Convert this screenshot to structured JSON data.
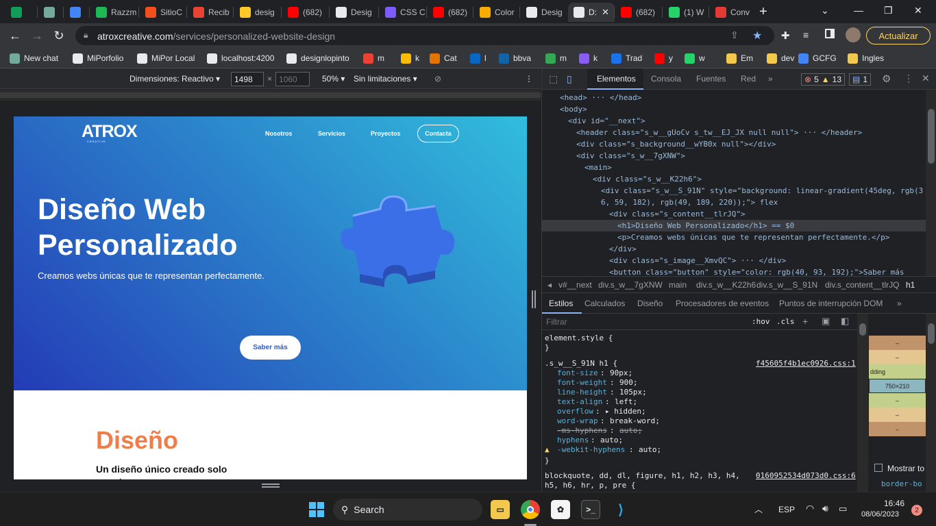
{
  "browser": {
    "tabs": [
      {
        "label": "",
        "icon": "sheets-icon",
        "color": "#0f9d58"
      },
      {
        "label": "",
        "icon": "chatgpt-icon",
        "color": "#74aa9c"
      },
      {
        "label": "",
        "icon": "docs-icon",
        "color": "#4285f4"
      },
      {
        "label": "Razzm",
        "icon": "spotify-icon",
        "color": "#1db954"
      },
      {
        "label": "SitioC",
        "icon": "figma-icon",
        "color": "#f24e1e"
      },
      {
        "label": "Recib",
        "icon": "gmail-icon",
        "color": "#ea4335"
      },
      {
        "label": "desig",
        "icon": "firebase-icon",
        "color": "#ffca28"
      },
      {
        "label": "(682)",
        "icon": "youtube-icon",
        "color": "#ff0000"
      },
      {
        "label": "Desig",
        "icon": "atrox-icon",
        "color": "#e8eaed"
      },
      {
        "label": "CSS C",
        "icon": "css-icon",
        "color": "#7c5cff"
      },
      {
        "label": "(682)",
        "icon": "youtube-icon",
        "color": "#ff0000"
      },
      {
        "label": "Color",
        "icon": "color-icon",
        "color": "#f9ab00"
      },
      {
        "label": "Desig",
        "icon": "atrox-icon",
        "color": "#e8eaed"
      },
      {
        "label": "D:",
        "icon": "atrox-icon",
        "color": "#e8eaed",
        "active": true
      },
      {
        "label": "(682)",
        "icon": "youtube-icon",
        "color": "#ff0000"
      },
      {
        "label": "(1) W",
        "icon": "whatsapp-icon",
        "color": "#25d366"
      },
      {
        "label": "Conv",
        "icon": "converter-icon",
        "color": "#e53935"
      }
    ],
    "new_tab": "+",
    "url_domain": "atroxcreative.com",
    "url_path": "/services/personalized-website-design",
    "update_button": "Actualizar",
    "bookmarks": [
      {
        "label": "New chat",
        "icon": "chatgpt-icon",
        "color": "#74aa9c"
      },
      {
        "label": "MiPorfolio",
        "icon": "atrox-icon",
        "color": "#e8eaed"
      },
      {
        "label": "MiPor Local",
        "icon": "atrox-icon",
        "color": "#e8eaed"
      },
      {
        "label": "localhost:4200",
        "icon": "atrox-icon",
        "color": "#e8eaed"
      },
      {
        "label": "designlopinto",
        "icon": "atrox-icon",
        "color": "#e8eaed"
      },
      {
        "label": "m",
        "icon": "gmail-icon",
        "color": "#ea4335"
      },
      {
        "label": "k",
        "icon": "keep-icon",
        "color": "#fbbc04"
      },
      {
        "label": "Cat",
        "icon": "cat-icon",
        "color": "#e37400"
      },
      {
        "label": "l",
        "icon": "linkedin-icon",
        "color": "#0a66c2"
      },
      {
        "label": "bbva",
        "icon": "bbva-icon",
        "color": "#1464a5"
      },
      {
        "label": "m",
        "icon": "maps-icon",
        "color": "#34a853"
      },
      {
        "label": "k",
        "icon": "kick-icon",
        "color": "#8a5cf6"
      },
      {
        "label": "Trad",
        "icon": "translate-icon",
        "color": "#1a73e8"
      },
      {
        "label": "y",
        "icon": "youtube-icon",
        "color": "#ff0000"
      },
      {
        "label": "w",
        "icon": "whatsapp-icon",
        "color": "#25d366"
      },
      {
        "label": "Em",
        "icon": "folder-icon",
        "color": "#f2c94c"
      },
      {
        "label": "dev",
        "icon": "folder-icon",
        "color": "#f2c94c"
      },
      {
        "label": "GCFG",
        "icon": "gcfg-icon",
        "color": "#4285f4"
      },
      {
        "label": "Ingles",
        "icon": "folder-icon",
        "color": "#f2c94c"
      }
    ]
  },
  "device_toolbar": {
    "dimensions_label": "Dimensiones: Reactivo",
    "width": "1498",
    "height_placeholder": "1060",
    "zoom": "50%",
    "throttle": "Sin limitaciones"
  },
  "site": {
    "logo": "ATROX",
    "logo_sub": "CREATIVE",
    "nav": [
      "Nosotros",
      "Servicios",
      "Proyectos"
    ],
    "contact": "Contacta",
    "title": "Diseño Web Personalizado",
    "subtitle": "Creamos webs únicas que te representan perfectamente.",
    "cta": "Saber más",
    "section_title": "Diseño",
    "section_sub": "Un diseño único creado solo para tu marca",
    "hero_gradient_start": "#243bb6",
    "hero_gradient_end": "#31bddc",
    "section_title_color": "#ef7f4a"
  },
  "devtools": {
    "tabs": [
      "Elementos",
      "Consola",
      "Fuentes",
      "Red"
    ],
    "errors": "5",
    "warnings": "13",
    "messages": "1",
    "dom_lines": [
      {
        "indent": 0,
        "html": "<head> ··· </head>"
      },
      {
        "indent": 0,
        "html": "<body>"
      },
      {
        "indent": 1,
        "html": "<div id=\"__next\">"
      },
      {
        "indent": 2,
        "html": "<header class=\"s_w__gUoCv s_tw__EJ_JX null  null\"> ··· </header>"
      },
      {
        "indent": 2,
        "html": "<div class=\"s_background__wYB0x null\"></div>"
      },
      {
        "indent": 2,
        "html": "<div class=\"s_w__7gXNW\">"
      },
      {
        "indent": 3,
        "html": "<main>"
      },
      {
        "indent": 4,
        "html": "<div class=\"s_w__K22h6\">"
      },
      {
        "indent": 5,
        "html": "<div class=\"s_w__S_91N\" style=\"background: linear-gradient(45deg, rgb(3"
      },
      {
        "indent": 5,
        "html": "6, 59, 182), rgb(49, 189, 220));\"> flex"
      },
      {
        "indent": 6,
        "html": "<div class=\"s_content__tlrJQ\">"
      },
      {
        "indent": 7,
        "html": "<h1>Diseño Web Personalizado</h1> == $0"
      },
      {
        "indent": 7,
        "html": "<p>Creamos webs únicas que te representan perfectamente.</p>"
      },
      {
        "indent": 6,
        "html": "</div>"
      },
      {
        "indent": 6,
        "html": "<div class=\"s_image__XmvQC\"> ··· </div>"
      },
      {
        "indent": 6,
        "html": "<button class=\"button\" style=\"color: rgb(40, 93, 192);\">Saber más"
      }
    ],
    "breadcrumbs": [
      "v#__next",
      "div.s_w__7gXNW",
      "main",
      "div.s_w__K22h6",
      "div.s_w__S_91N",
      "div.s_content__tlrJQ",
      "h1"
    ],
    "style_tabs": [
      "Estilos",
      "Calculados",
      "Diseño",
      "Procesadores de eventos",
      "Puntos de interrupción DOM"
    ],
    "filter_placeholder": "Filtrar",
    "hov": ":hov",
    "cls": ".cls",
    "element_style": "element.style {",
    "rule_selector": ".s_w__S_91N h1 {",
    "rule_source": "f45605f4b1ec0926.css:1",
    "props": [
      {
        "name": "font-size",
        "value": "90px;"
      },
      {
        "name": "font-weight",
        "value": "900;"
      },
      {
        "name": "line-height",
        "value": "105px;"
      },
      {
        "name": "text-align",
        "value": "left;"
      },
      {
        "name": "overflow",
        "value": "▸ hidden;"
      },
      {
        "name": "word-wrap",
        "value": "break-word;"
      },
      {
        "name": "-ms-hyphens",
        "value": "auto;",
        "struck": true
      },
      {
        "name": "hyphens",
        "value": "auto;"
      },
      {
        "name": "-webkit-hyphens",
        "value": "auto;",
        "warn": true
      }
    ],
    "rule2_selector": "blockquote, dd, dl, figure, h1, h2, h3, h4,",
    "rule2_selector_b": "h5, h6, hr, p, pre {",
    "rule2_source": "0160952534d073d0.css:6",
    "boxmodel_size": "750×210",
    "boxmodel_label": "dding",
    "show_all": "Mostrar to",
    "border_prop": "border-bo"
  },
  "taskbar": {
    "search": "Search",
    "lang": "ESP",
    "time": "16:46",
    "date": "08/06/2023",
    "notifications": "2"
  }
}
